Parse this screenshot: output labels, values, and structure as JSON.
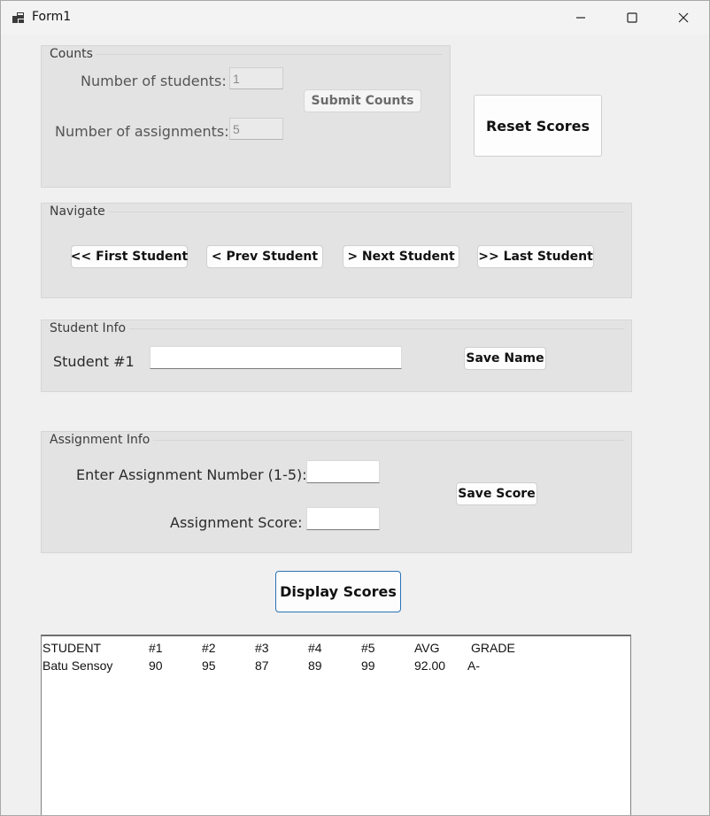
{
  "window": {
    "title": "Form1"
  },
  "counts": {
    "group_title": "Counts",
    "students_label": "Number of students:",
    "students_value": "1",
    "assignments_label": "Number of assignments:",
    "assignments_value": "5",
    "submit_label": "Submit Counts"
  },
  "reset_label": "Reset Scores",
  "navigate": {
    "group_title": "Navigate",
    "first_label": "<< First Student",
    "prev_label": "< Prev Student",
    "next_label": "> Next Student",
    "last_label": ">> Last Student"
  },
  "student_info": {
    "group_title": "Student Info",
    "student_label": "Student #1",
    "name_value": "",
    "save_name_label": "Save Name"
  },
  "assignment_info": {
    "group_title": "Assignment Info",
    "number_label": "Enter Assignment Number (1-5):",
    "number_value": "",
    "score_label": "Assignment Score:",
    "score_value": "",
    "save_score_label": "Save Score"
  },
  "display_label": "Display Scores",
  "scores": {
    "headers": [
      "STUDENT",
      "#1",
      "#2",
      "#3",
      "#4",
      "#5",
      "AVG",
      "GRADE"
    ],
    "rows": [
      [
        "Batu Sensoy",
        "90",
        "95",
        "87",
        "89",
        "99",
        "92.00",
        "A-"
      ]
    ]
  },
  "colors": {
    "accent_border": "#2a73b8",
    "group_bg": "#e3e3e3",
    "window_bg": "#f0f0f0"
  }
}
